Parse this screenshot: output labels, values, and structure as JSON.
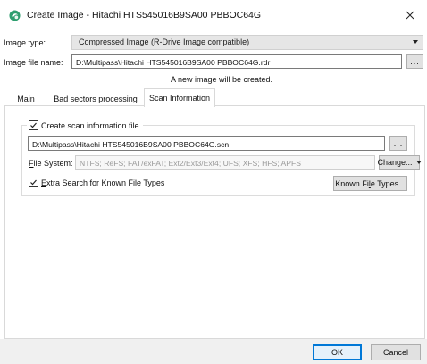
{
  "window": {
    "title": "Create Image - Hitachi HTS545016B9SA00 PBBOC64G",
    "close_icon": "close-icon",
    "app_icon": "rstudio-app-icon"
  },
  "image_type": {
    "label": "Image type:",
    "value": "Compressed Image (R-Drive Image compatible)"
  },
  "image_file": {
    "label": "Image file name:",
    "value": "D:\\Multipass\\Hitachi HTS545016B9SA00 PBBOC64G.rdr",
    "browse_label": "..."
  },
  "status_text": "A new image will be created.",
  "tabs": [
    {
      "label": "Main",
      "active": false
    },
    {
      "label": "Bad sectors processing",
      "active": false
    },
    {
      "label": "Scan Information",
      "active": true
    }
  ],
  "scan_info": {
    "create_checkbox": {
      "label": "Create scan information file",
      "checked": true
    },
    "file_path": "D:\\Multipass\\Hitachi HTS545016B9SA00 PBBOC64G.scn",
    "browse_label": "...",
    "fs_label_first": "F",
    "fs_label_rest": "ile System:",
    "fs_value": "NTFS; ReFS; FAT/exFAT; Ext2/Ext3/Ext4; UFS; XFS; HFS; APFS",
    "change_button": "Change...",
    "extra_checkbox": {
      "label_first": "E",
      "label_rest": "xtra Search for Known File Types",
      "checked": true
    },
    "known_button_pre": "Known Fi",
    "known_button_ul": "l",
    "known_button_post": "e Types..."
  },
  "footer": {
    "ok_label": "OK",
    "cancel_label": "Cancel"
  },
  "colors": {
    "accent": "#0078d7",
    "app_icon_green": "#2e9e6f"
  }
}
